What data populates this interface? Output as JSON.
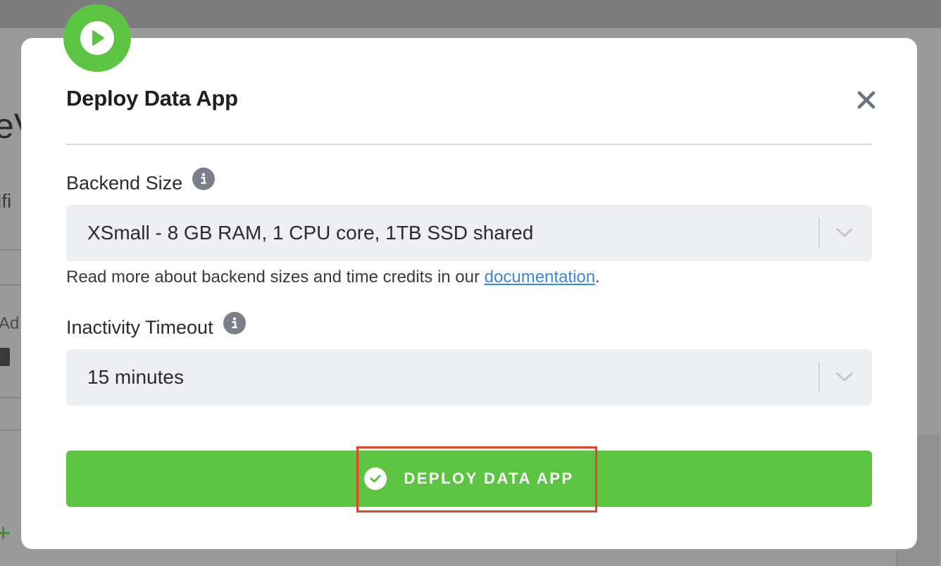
{
  "background": {
    "fragments": {
      "heading": "eV",
      "subheading": "ifi",
      "row_text": "Ad",
      "plus": "+"
    }
  },
  "modal": {
    "title": "Deploy Data App",
    "badge_icon": "play-icon",
    "close_icon": "close-icon",
    "backend_size": {
      "label": "Backend Size",
      "info_icon": "info-icon",
      "selected": "XSmall - 8 GB RAM, 1 CPU core, 1TB SSD shared",
      "chevron_icon": "chevron-down-icon"
    },
    "help": {
      "prefix": "Read more about backend sizes and time credits in our ",
      "link": "documentation",
      "suffix": "."
    },
    "inactivity_timeout": {
      "label": "Inactivity Timeout",
      "info_icon": "info-icon",
      "selected": "15 minutes",
      "chevron_icon": "chevron-down-icon"
    },
    "deploy_button": {
      "label": "DEPLOY DATA APP",
      "icon": "check-circle-icon"
    }
  },
  "colors": {
    "accent_green": "#5dc343",
    "link_blue": "#3d86de",
    "highlight_red": "#e2462a",
    "modal_bg": "#ffffff",
    "select_bg": "#eeeff2"
  }
}
